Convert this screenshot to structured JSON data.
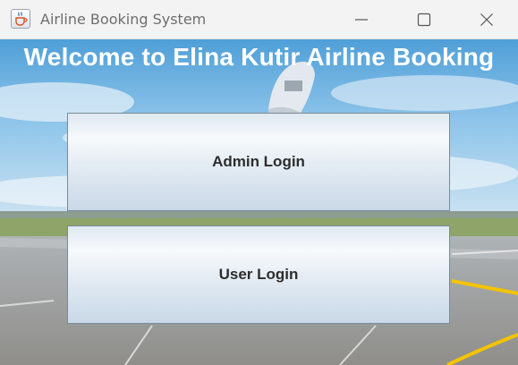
{
  "window": {
    "title": "Airline Booking System",
    "app_icon": "java-cup-icon",
    "controls": {
      "minimize": "minimize-icon",
      "maximize": "maximize-icon",
      "close": "close-icon"
    }
  },
  "main": {
    "heading": "Welcome to Elina Kutir Airline Booking",
    "buttons": {
      "admin_label": "Admin Login",
      "user_label": "User Login"
    }
  },
  "colors": {
    "heading_text": "#ffffff",
    "button_text": "#2d2d2d",
    "titlebar_bg": "#f3f3f3",
    "runway_line": "#f5c400"
  }
}
